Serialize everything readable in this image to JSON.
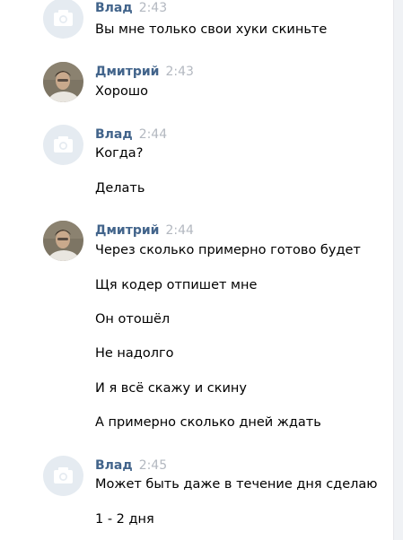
{
  "groups": [
    {
      "author": "Влад",
      "time": "2:43",
      "avatar": "camera-placeholder-icon",
      "messages": [
        "Вы мне только свои хуки скиньте"
      ]
    },
    {
      "author": "Дмитрий",
      "time": "2:43",
      "avatar": "user-photo",
      "messages": [
        "Хорошо"
      ]
    },
    {
      "author": "Влад",
      "time": "2:44",
      "avatar": "camera-placeholder-icon",
      "messages": [
        "Когда?",
        "Делать"
      ]
    },
    {
      "author": "Дмитрий",
      "time": "2:44",
      "avatar": "user-photo",
      "messages": [
        "Через сколько примерно готово будет",
        "Щя кодер отпишет мне",
        "Он отошёл",
        "Не надолго",
        "И я всё скажу и скину",
        "А примерно сколько дней ждать"
      ]
    },
    {
      "author": "Влад",
      "time": "2:45",
      "avatar": "camera-placeholder-icon",
      "messages": [
        "Может быть даже в течение дня сделаю",
        "1 - 2 дня"
      ]
    }
  ],
  "colors": {
    "author": "#42648b",
    "time": "#b3b8c0",
    "placeholder_bg": "#e5ebf1",
    "placeholder_icon": "#ffffff"
  }
}
